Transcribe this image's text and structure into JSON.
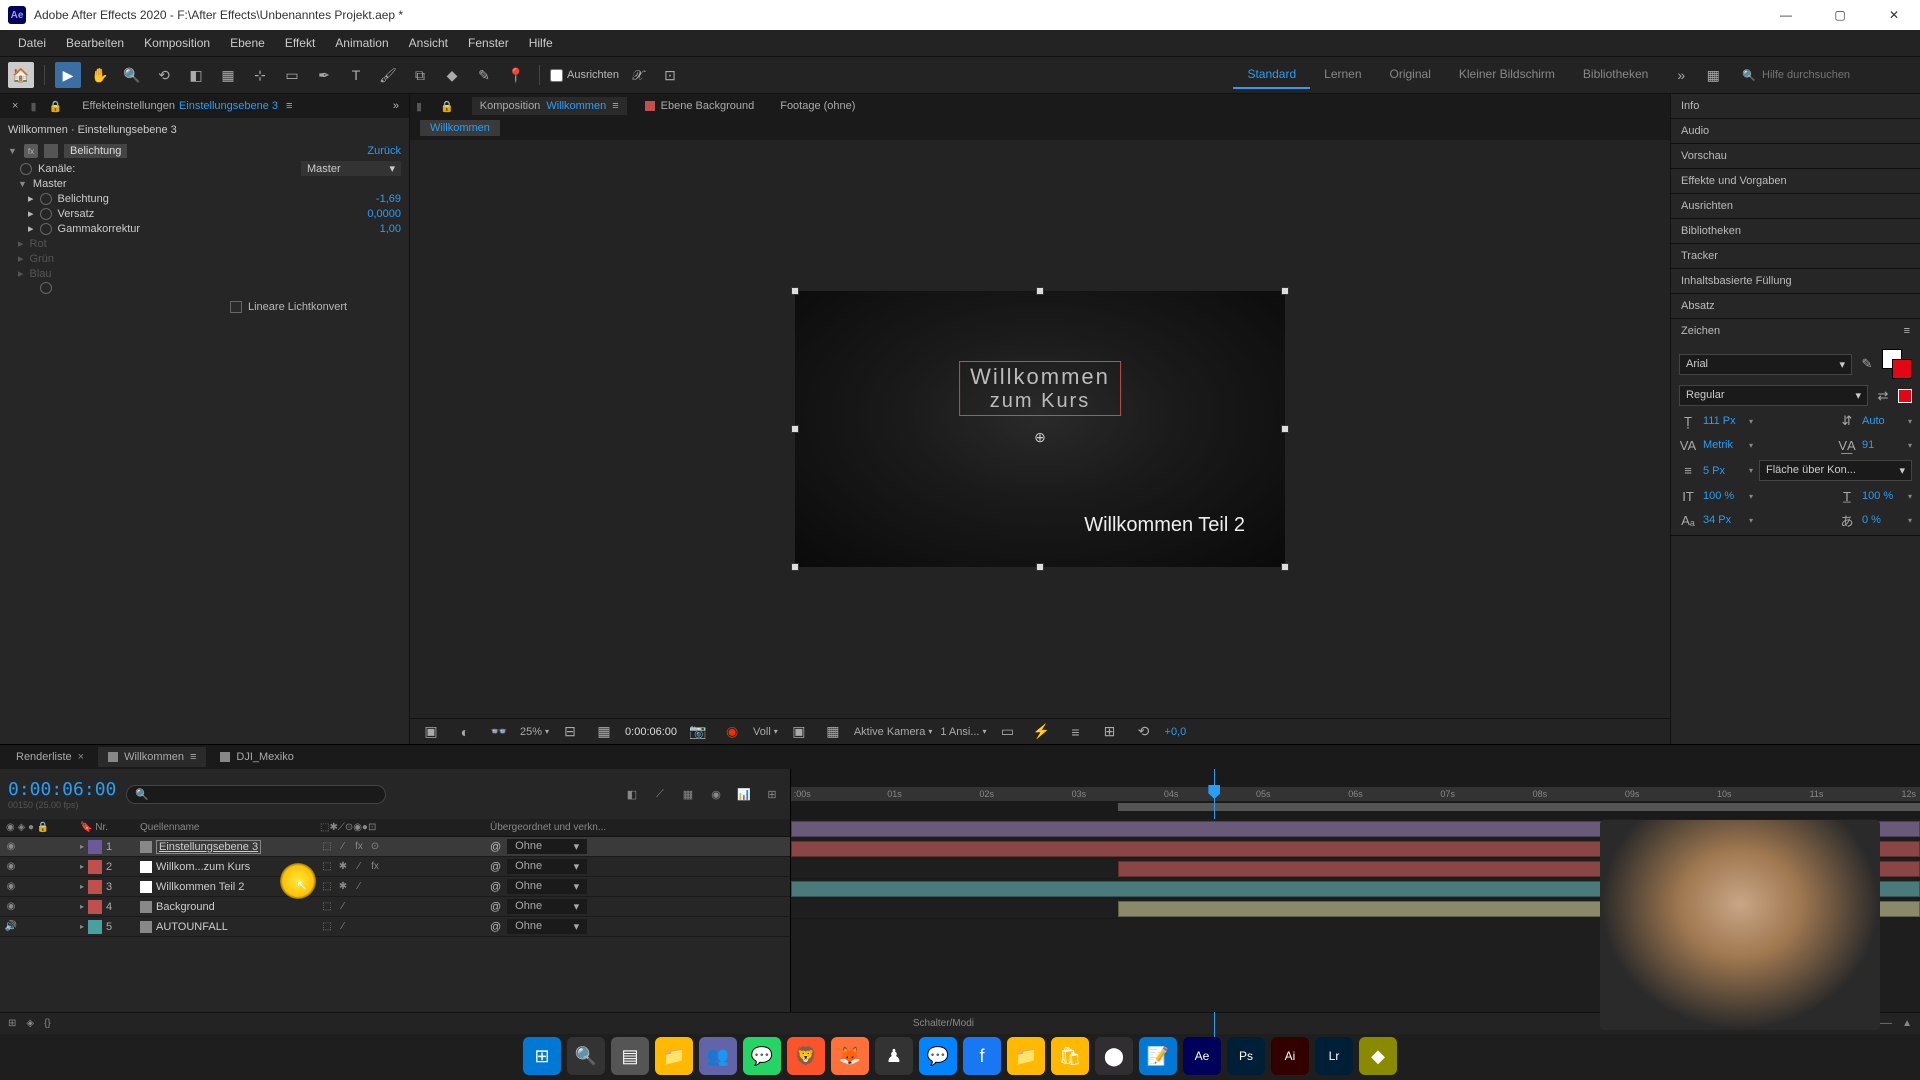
{
  "titlebar": {
    "app_short": "Ae",
    "title": "Adobe After Effects 2020 - F:\\After Effects\\Unbenanntes Projekt.aep *"
  },
  "menubar": [
    "Datei",
    "Bearbeiten",
    "Komposition",
    "Ebene",
    "Effekt",
    "Animation",
    "Ansicht",
    "Fenster",
    "Hilfe"
  ],
  "toolbar": {
    "align_label": "Ausrichten",
    "search_placeholder": "Hilfe durchsuchen"
  },
  "workspaces": [
    "Standard",
    "Lernen",
    "Original",
    "Kleiner Bildschirm",
    "Bibliotheken"
  ],
  "effect_controls": {
    "tab_prefix": "Effekteinstellungen",
    "tab_link": "Einstellungsebene 3",
    "header": "Willkommen · Einstellungsebene 3",
    "effect_name": "Belichtung",
    "reset": "Zurück",
    "channels_label": "Kanäle:",
    "channels_value": "Master",
    "master": "Master",
    "props": {
      "belichtung": {
        "label": "Belichtung",
        "value": "-1,69"
      },
      "versatz": {
        "label": "Versatz",
        "value": "0,0000"
      },
      "gamma": {
        "label": "Gammakorrektur",
        "value": "1,00"
      }
    },
    "dim_channels": [
      "Rot",
      "Grün",
      "Blau"
    ],
    "checkbox": "Lineare Lichtkonvert"
  },
  "comp_panel": {
    "tab_prefix": "Komposition",
    "tab_link": "Willkommen",
    "layer_tab": "Ebene Background",
    "footage_tab": "Footage (ohne)",
    "breadcrumb": "Willkommen",
    "text1_line1": "Willkommen",
    "text1_line2": "zum Kurs",
    "text2": "Willkommen Teil 2"
  },
  "viewer_controls": {
    "zoom": "25%",
    "timecode": "0:00:06:00",
    "resolution": "Voll",
    "camera": "Aktive Kamera",
    "views": "1 Ansi...",
    "exposure": "+0,0"
  },
  "right_panels": [
    "Info",
    "Audio",
    "Vorschau",
    "Effekte und Vorgaben",
    "Ausrichten",
    "Bibliotheken",
    "Tracker",
    "Inhaltsbasierte Füllung",
    "Absatz"
  ],
  "character": {
    "title": "Zeichen",
    "font": "Arial",
    "style": "Regular",
    "size": "111 Px",
    "leading": "Auto",
    "kerning": "Metrik",
    "tracking": "91",
    "stroke": "5 Px",
    "stroke_opt": "Fläche über Kon...",
    "vscale": "100 %",
    "hscale": "100 %",
    "baseline": "34 Px",
    "tsume": "0 %"
  },
  "timeline": {
    "tabs": {
      "render": "Renderliste",
      "comp": "Willkommen",
      "other": "DJI_Mexiko"
    },
    "timecode": "0:00:06:00",
    "framerate": "00150 (25.00 fps)",
    "cols": {
      "num": "Nr.",
      "name": "Quellenname",
      "parent": "Übergeordnet und verkn..."
    },
    "parent_none": "Ohne",
    "footer": "Schalter/Modi",
    "ruler": [
      ":00s",
      "01s",
      "02s",
      "03s",
      "04s",
      "05s",
      "06s",
      "07s",
      "08s",
      "09s",
      "10s",
      "11s",
      "12s"
    ],
    "layers": [
      {
        "num": "1",
        "name": "Einstellungsebene 3",
        "color": "#6a5a9a",
        "type": "adj",
        "switches": "⬚ ∕ fx ⊙",
        "selected": true,
        "boxed": true,
        "bar": "purple",
        "bar_start": 0,
        "bar_end": 100
      },
      {
        "num": "2",
        "name": "Willkom...zum Kurs",
        "color": "#c0504d",
        "type": "T",
        "switches": "⬚ ✱ ∕ fx",
        "bar": "red",
        "bar_start": 0,
        "bar_end": 100
      },
      {
        "num": "3",
        "name": "Willkommen Teil 2",
        "color": "#c0504d",
        "type": "T",
        "switches": "⬚ ✱ ∕",
        "bar": "red",
        "bar_start": 29,
        "bar_end": 100
      },
      {
        "num": "4",
        "name": "Background",
        "color": "#c0504d",
        "type": "img",
        "switches": "⬚ ∕",
        "bar": "teal",
        "bar_start": 0,
        "bar_end": 100
      },
      {
        "num": "5",
        "name": "AUTOUNFALL",
        "color": "#4aa0a0",
        "type": "audio",
        "switches": "⬚ ∕",
        "bar": "tan",
        "bar_start": 29,
        "bar_end": 100,
        "audio_only": true
      }
    ]
  },
  "taskbar_apps": [
    "windows",
    "search",
    "explorer-alt",
    "explorer",
    "teams",
    "whatsapp",
    "brave",
    "firefox",
    "chess",
    "messenger",
    "facebook",
    "folder",
    "shop",
    "obs",
    "notes",
    "ae",
    "ps",
    "ai",
    "lr",
    "misc"
  ]
}
